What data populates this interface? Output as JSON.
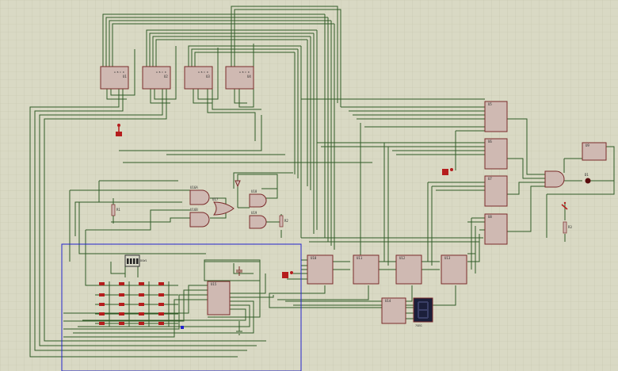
{
  "app": {
    "name": "Proteus ISIS schematic",
    "colors": {
      "background": "#d9d9c4",
      "grid": "#c8c8b2",
      "wire": "#2f5a26",
      "chip_fill": "#cfb9b2",
      "chip_stroke": "#7a2a2a",
      "accent_red": "#b51d1d",
      "selection_box": "#2222cc"
    }
  },
  "chips": [
    {
      "id": "chip-u1",
      "label": "U1"
    },
    {
      "id": "chip-u2",
      "label": "U2"
    },
    {
      "id": "chip-u3",
      "label": "U3"
    },
    {
      "id": "chip-u4",
      "label": "U4"
    },
    {
      "id": "chip-u5",
      "label": "U5"
    },
    {
      "id": "chip-u6",
      "label": "U6"
    },
    {
      "id": "chip-u7",
      "label": "U7"
    },
    {
      "id": "chip-u8",
      "label": "U8"
    },
    {
      "id": "chip-u9",
      "label": "U9"
    },
    {
      "id": "chip-u10",
      "label": "U10"
    },
    {
      "id": "chip-u11",
      "label": "U11"
    },
    {
      "id": "chip-u12",
      "label": "U12"
    },
    {
      "id": "chip-u13",
      "label": "U13"
    },
    {
      "id": "chip-u14",
      "label": "U14"
    },
    {
      "id": "chip-u15",
      "label": "U15"
    }
  ],
  "gates": [
    {
      "id": "gate-u16a",
      "label": "U16A"
    },
    {
      "id": "gate-u16b",
      "label": "U16B"
    },
    {
      "id": "gate-u17",
      "label": "U17"
    },
    {
      "id": "gate-u18",
      "label": "U18"
    },
    {
      "id": "gate-u19",
      "label": "U19"
    }
  ],
  "resistors": [
    {
      "id": "resistor-r1",
      "label": "R1"
    },
    {
      "id": "resistor-r2",
      "label": "R2"
    },
    {
      "id": "resistor-r3",
      "label": "R3"
    }
  ],
  "display": {
    "label": "7SEG"
  },
  "dip_switch": {
    "label": "DSW1"
  },
  "led": {
    "label": "D1"
  }
}
